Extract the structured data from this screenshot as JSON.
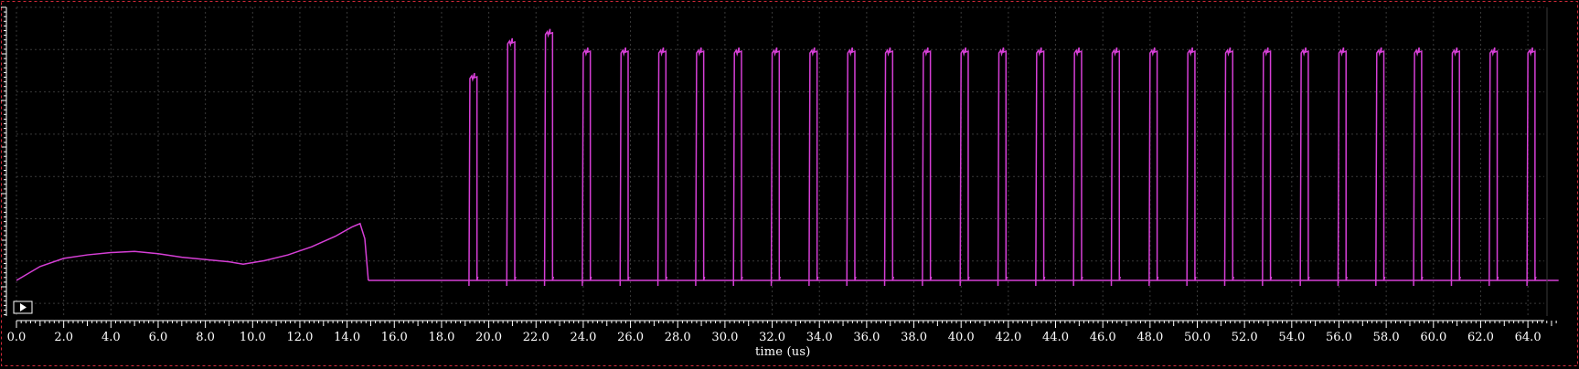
{
  "colors": {
    "background": "#000000",
    "grid": "#3a3a3a",
    "axis": "#ffffff",
    "trace": "#d63fd6",
    "border_dash": "#d22a3a",
    "play_button": "#ffffff"
  },
  "chart_data": {
    "type": "line",
    "title": "",
    "xlabel": "time (us)",
    "ylabel": "",
    "xlim": [
      0,
      65.3
    ],
    "ylim": [
      0,
      1
    ],
    "grid": true,
    "legend": "none",
    "x_ticks": [
      "0.0",
      "2.0",
      "4.0",
      "6.0",
      "8.0",
      "10.0",
      "12.0",
      "14.0",
      "16.0",
      "18.0",
      "20.0",
      "22.0",
      "24.0",
      "26.0",
      "28.0",
      "30.0",
      "32.0",
      "34.0",
      "36.0",
      "38.0",
      "40.0",
      "42.0",
      "44.0",
      "46.0",
      "48.0",
      "50.0",
      "52.0",
      "54.0",
      "56.0",
      "58.0",
      "60.0",
      "62.0",
      "64.0"
    ],
    "series": [
      {
        "name": "",
        "color": "#d63fd6",
        "startup_curve": {
          "x": [
            0.0,
            1.0,
            2.0,
            3.0,
            4.0,
            5.0,
            6.0,
            7.0,
            8.0,
            9.0,
            9.6,
            10.5,
            11.5,
            12.5,
            13.5,
            14.2,
            14.55,
            14.75,
            14.9
          ],
          "y": [
            0.0,
            0.06,
            0.095,
            0.11,
            0.12,
            0.125,
            0.115,
            0.1,
            0.09,
            0.08,
            0.07,
            0.085,
            0.11,
            0.145,
            0.19,
            0.23,
            0.245,
            0.18,
            0.0
          ]
        },
        "baseline_after_startup": {
          "x_start": 14.9,
          "x_end": 65.3,
          "y": 0.0
        },
        "pulses": {
          "rise_x": [
            19.2,
            20.8,
            22.4,
            24.0,
            25.6,
            27.2,
            28.8,
            30.4,
            32.0,
            33.6,
            35.2,
            36.8,
            38.4,
            40.0,
            41.6,
            43.2,
            44.8,
            46.4,
            48.0,
            49.6,
            51.2,
            52.8,
            54.4,
            56.0,
            57.6,
            59.2,
            60.8,
            62.4,
            64.0
          ],
          "width": 0.3,
          "high_y": [
            0.87,
            1.02,
            1.06,
            0.98,
            0.98,
            0.98,
            0.98,
            0.98,
            0.98,
            0.98,
            0.98,
            0.98,
            0.98,
            0.98,
            0.98,
            0.98,
            0.98,
            0.98,
            0.98,
            0.98,
            0.98,
            0.98,
            0.98,
            0.98,
            0.98,
            0.98,
            0.98,
            0.98,
            0.98
          ]
        }
      }
    ]
  }
}
